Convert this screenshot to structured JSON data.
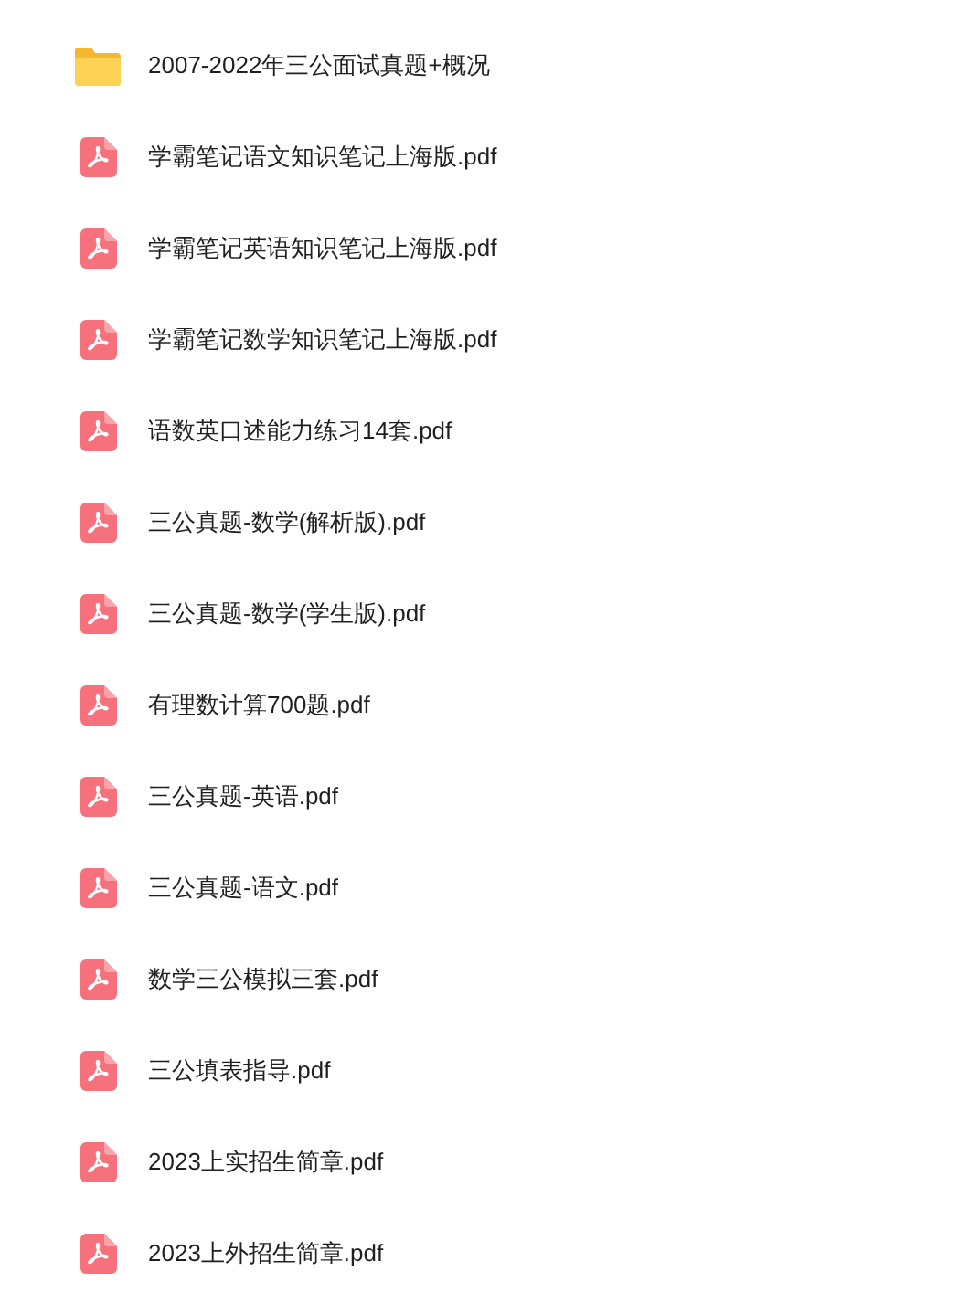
{
  "files": [
    {
      "kind": "folder",
      "name": "2007-2022年三公面试真题+概况"
    },
    {
      "kind": "pdf",
      "name": "学霸笔记语文知识笔记上海版.pdf"
    },
    {
      "kind": "pdf",
      "name": "学霸笔记英语知识笔记上海版.pdf"
    },
    {
      "kind": "pdf",
      "name": "学霸笔记数学知识笔记上海版.pdf"
    },
    {
      "kind": "pdf",
      "name": "语数英口述能力练习14套.pdf"
    },
    {
      "kind": "pdf",
      "name": "三公真题-数学(解析版).pdf"
    },
    {
      "kind": "pdf",
      "name": "三公真题-数学(学生版).pdf"
    },
    {
      "kind": "pdf",
      "name": "有理数计算700题.pdf"
    },
    {
      "kind": "pdf",
      "name": "三公真题-英语.pdf"
    },
    {
      "kind": "pdf",
      "name": "三公真题-语文.pdf"
    },
    {
      "kind": "pdf",
      "name": "数学三公模拟三套.pdf"
    },
    {
      "kind": "pdf",
      "name": "三公填表指导.pdf"
    },
    {
      "kind": "pdf",
      "name": "2023上实招生简章.pdf"
    },
    {
      "kind": "pdf",
      "name": "2023上外招生简章.pdf"
    }
  ]
}
